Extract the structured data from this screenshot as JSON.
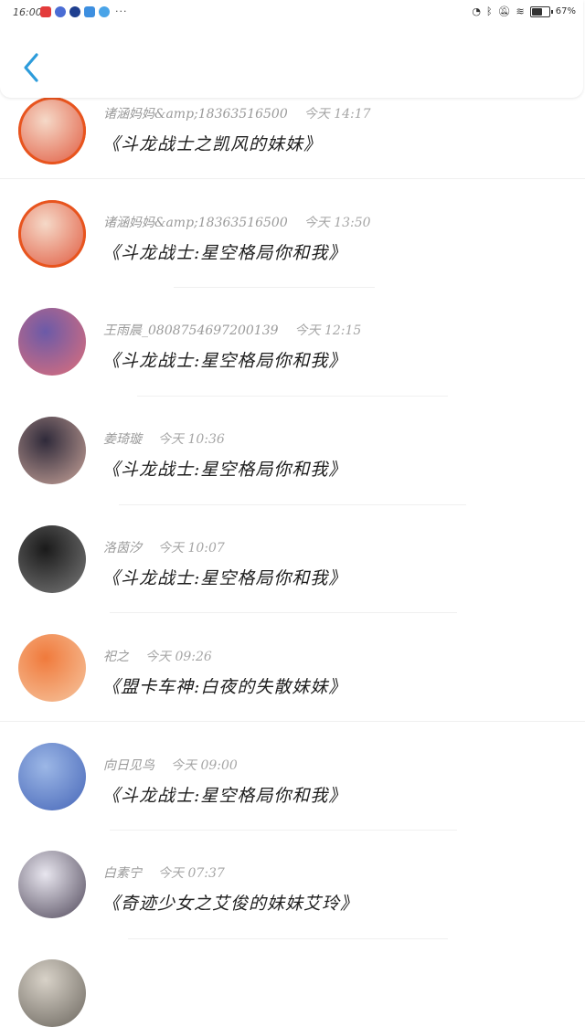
{
  "status_bar": {
    "time": "16:00",
    "dots": "···",
    "battery_percent": "67%",
    "battery_level": 0.67
  },
  "header": {
    "back_icon": "chevron-left-icon",
    "accent": "#2d9cdb"
  },
  "messages": [
    {
      "author": "诸涵妈妈&amp;18363516500",
      "time": "今天 14:17",
      "title": "《斗龙战士之凯风的妹妹》",
      "avatar_colors": [
        "#f5d9c8",
        "#e0553a"
      ]
    },
    {
      "author": "诸涵妈妈&amp;18363516500",
      "time": "今天 13:50",
      "title": "《斗龙战士:星空格局你和我》",
      "avatar_colors": [
        "#f5d9c8",
        "#e0553a"
      ]
    },
    {
      "author": "王雨晨_0808754697200139",
      "time": "今天 12:15",
      "title": "《斗龙战士:星空格局你和我》",
      "avatar_colors": [
        "#6b5aa8",
        "#e06f7a"
      ]
    },
    {
      "author": "姜琦璇",
      "time": "今天 10:36",
      "title": "《斗龙战士:星空格局你和我》",
      "avatar_colors": [
        "#2f2a3a",
        "#c9a49a"
      ]
    },
    {
      "author": "洛茵汐",
      "time": "今天 10:07",
      "title": "《斗龙战士:星空格局你和我》",
      "avatar_colors": [
        "#1a1a1a",
        "#7a7a7a"
      ]
    },
    {
      "author": "祀之",
      "time": "今天 09:26",
      "title": "《盟卡车神:白夜的失散妹妹》",
      "avatar_colors": [
        "#f07a3c",
        "#f6c6a0"
      ]
    },
    {
      "author": "向日见鸟",
      "time": "今天 09:00",
      "title": "《斗龙战士:星空格局你和我》",
      "avatar_colors": [
        "#9cb7e6",
        "#4666b8"
      ]
    },
    {
      "author": "白素宁",
      "time": "今天 07:37",
      "title": "《奇迹少女之艾俊的妹妹艾玲》",
      "avatar_colors": [
        "#e8e6ef",
        "#50485a"
      ]
    }
  ]
}
